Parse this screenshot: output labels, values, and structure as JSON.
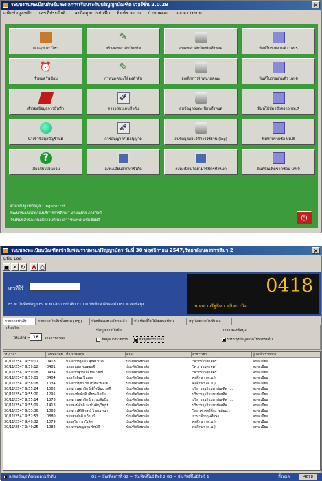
{
  "window1": {
    "title": "ระบบงานทะเบียนศิษย์และผลการเรียนระดับปริญญาบัณฑิต เวอร์ชั่น 2.0.29",
    "menu": [
      "แฟ้มข้อมูลหลัก",
      "เลขที่ประจำตัว",
      "ลงข้อมูลการบันทึก",
      "พิมพ์รายงาน",
      "กำหนดเอง",
      "ออกจากระบบ"
    ],
    "buttons": [
      {
        "label": "คณะ/สาขาวิชา",
        "icon": "briefcase-icon"
      },
      {
        "label": "สร้างเลขลำดับบัณฑิต",
        "icon": "pen-card-icon"
      },
      {
        "label": "ลบเลขลำดับบัณฑิตทั้งหมด",
        "icon": "database-drum-icon"
      },
      {
        "label": "พิมพ์ใบรายงานตัว บท.5",
        "icon": "print-folder-icon"
      },
      {
        "label": "กำหนดวันซ้อม",
        "icon": "alarm-clock-icon"
      },
      {
        "label": "กำหนดคณะให้ลงลำดับ",
        "icon": "pen-card-icon"
      },
      {
        "label": "ยกเลิกการจำหน่ายคณะ",
        "icon": "database-drum-icon"
      },
      {
        "label": "พิมพ์ใบรายงานตัว บท.6",
        "icon": "print-folder-icon"
      },
      {
        "label": "สำรองข้อมูลการบันทึก",
        "icon": "book-icon"
      },
      {
        "label": "ตรวจสอบเลขลำดับ",
        "icon": "pencil-card-icon"
      },
      {
        "label": "ลบข้อมูลลงทะเบียนทั้งหมด",
        "icon": "database-drum-icon"
      },
      {
        "label": "พิมพ์ใบ้บัตรชั่วคราว บท.7",
        "icon": "print-folder-icon"
      },
      {
        "label": "นำเข้าข้อมูลบัญชีใหม่",
        "icon": "globe-icon"
      },
      {
        "label": "การอนุญาต/ไม่อนุญาต",
        "icon": "pencil-card-icon"
      },
      {
        "label": "ลบข้อมูลประวัติการใช้งาน (log)",
        "icon": "database-drum-icon"
      },
      {
        "label": "พิมพ์ใบรายชื่อ บท.8",
        "icon": "print-folder-icon"
      },
      {
        "label": "เกี่ยวกับโปรแกรม",
        "icon": "help-icon"
      },
      {
        "label": "ลงทะเบียนจากบาร์โค้ด",
        "icon": "computer-icon"
      },
      {
        "label": "ลงทะเบียนโดยไม่ใช้บัตรทั้งหมด",
        "icon": "computer-icon"
      },
      {
        "label": "พิมพ์บัณฑิตขาดซ้อม บท.9",
        "icon": "print-folder-icon"
      }
    ],
    "footer_lines": [
      "ตำแหน่งฐานข้อมูล : register.txt",
      "พัฒนาระบบโดยกองบริการการศึกษา นายมงคล ภารกิจดี",
      "โรงพิมพ์สำนักงานอธิการบดี นางสาวชนกพร แช่มช้อยดี"
    ]
  },
  "window2": {
    "title": "ระบบลงทะเบียนบัณฑิตเข้ารับพระราชทานปริญญาบัตร วันที่ 30 พฤศจิกายน 2547,วิทยาลัยนครราชสีมา 2",
    "menu": [
      "แฟ้ม Log"
    ],
    "toolbar": [
      "save-icon",
      "delete-icon",
      "refresh-icon",
      "font-icon",
      "print-icon"
    ],
    "id_label": "เลขที่ใช้",
    "shortcut_hint": "F5 = บันทึกข้อมูล  F9 = ยกเลิกการบันทึก  F10 = บันทึกค่าดีฟอลต์  DEL = ลบข้อมูล",
    "big_number": "0418",
    "person_name": "นางสาวรัฐธิดา สุกิจปานิจ",
    "tabs": [
      "รายการบันทึก",
      "รายการบันทึกทั้งหมด (log)",
      "บัณฑิตลงทะเบียนแล้ว",
      "บัณฑิตที่ไม่ได้ลงทะเบียน",
      "สรุปผลการบันทึกผล"
    ],
    "filter": {
      "group_label": "เงื่อนไข",
      "show_label": "ให้แสดง =",
      "show_value": "18",
      "show_unit": "รายการล่าสุด",
      "save_label": "ข้อมูลการบันทึก :",
      "opt1": "ข้อมูลบางรายการ",
      "opt2": "ข้อมูลทุกรายการ",
      "display_label": "การแสดงข้อมูล :",
      "display_opt": "ปรับปรุงข้อมูลจากโปรแกรมอื่น"
    },
    "grid": {
      "headers": [
        "วัน/เวลา",
        "เลขที่ลำดับ",
        "ชื่อ-นามสกุล",
        "คณะ",
        "สาขาวิชา",
        "ผู้บันทึก/รายการ"
      ],
      "rows": [
        [
          "30/11/2547 9:59:17",
          "0418",
          "นางสาวรัฐธิดา สุกิจปานิจ",
          "บัณฑิตวิทยาลัย",
          "วิศวกรรมศาสตร์",
          "ลงทะเบียน"
        ],
        [
          "30/11/2547 9:59:12",
          "0481",
          "นายธนพล ชุมทองดี",
          "บัณฑิตวิทยาลัย",
          "วิศวกรรมศาสตร์",
          "ลงทะเบียน"
        ],
        [
          "30/11/2547 9:59:08",
          "0434",
          "นางสาวสุวรรณี ปิยะวัฒน์",
          "บัณฑิตวิทยาลัย",
          "วิศวกรรมศาสตร์",
          "ลงทะเบียน"
        ],
        [
          "30/11/2547 9:59:01",
          "0404",
          "นายทักษิณ ปิ่นทอง",
          "บัณฑิตวิทยาลัย",
          "ศุลศึกษา (ค.ม.)",
          "ลงทะเบียน"
        ],
        [
          "30/11/2547 9:58:18",
          "1034",
          "นางสาวนุชนาถ ศรีศิลาทองดี",
          "บัณฑิตวิทยาลัย",
          "ศุลศึกษา (ค.ม.)",
          "ลงทะเบียน"
        ],
        [
          "30/11/2547 9:55:24",
          "1062",
          "นางสาวสุดารัตน์ ดีใจนิ่มนวลดี",
          "บัณฑิตวิทยาลัย",
          "บริหารธุรกิจมหาบัณฑิต (...",
          "ลงทะเบียน"
        ],
        [
          "30/11/2547 9:55:20",
          "1295",
          "นายธงชัยศักดิ์ เจียระนัยชัย",
          "บัณฑิตวิทยาลัย",
          "บริหารธุรกิจมหาบัณฑิต (...",
          "ลงทะเบียน"
        ],
        [
          "30/11/2547 9:55:14",
          "1378",
          "นางสาวสุดารัตน์ ธรรมสันนิ่ม",
          "บัณฑิตวิทยาลัย",
          "บริหารธุรกิจมหาบัณฑิต (...",
          "ลงทะเบียน"
        ],
        [
          "30/11/2547 9:55:09",
          "1413",
          "นายพงษ์ศักดิ์ ระบำเพ็ญวิฑูรย์",
          "บัณฑิตวิทยาลัย",
          "บริหารธุรกิจมหาบัณฑิต (...",
          "ลงทะเบียน"
        ],
        [
          "30/11/2547 9:53:36",
          "1063",
          "นางสาวสิริลักษณ์ ไวยเวทนา",
          "บัณฑิตวิทยาลัย",
          "วิทยาศาสตร์สิ่งแวดล้อม...",
          "ลงทะเบียน"
        ],
        [
          "30/11/2547 9:52:53",
          "0880",
          "นายสมศักดิ์ แก้วมณี",
          "บัณฑิตวิทยาลัย",
          "ภาษาอังกฤษศึกษา",
          "ลงทะเบียน"
        ],
        [
          "30/11/2547 9:49:32",
          "1079",
          "นายสุริยา ยาวิเลิศ",
          "บัณฑิตวิทยาลัย",
          "ศุลศึกษา (ค.ม.)",
          "ลงทะเบียน"
        ],
        [
          "30/11/2547 9:49:25",
          "1082",
          "นางสาวเบญจพร รักษ์ดี",
          "บัณฑิตวิทยาลัย",
          "ศุลศึกษา (ค.ม.)",
          "ลงทะเบียน"
        ]
      ]
    },
    "status": {
      "left": "แสดงข้อมูลทั้งหมดตามลำดับ",
      "middle": "G1 = บัณฑิตเก่าที่  G2 = บัณฑิตที่ไม่มีสิทธิ 2  G3 = บัณฑิตที่ไม่มีสิทธิ 1",
      "right_label": "ทั้งหมด",
      "count": "4678"
    }
  }
}
